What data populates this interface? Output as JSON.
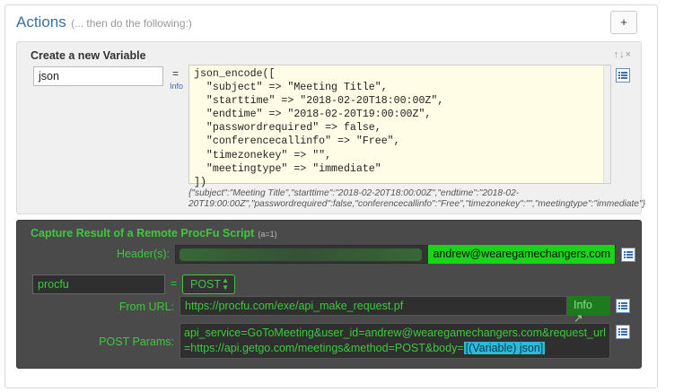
{
  "actions": {
    "title": "Actions",
    "subtitle": "(... then do the following:)",
    "add_label": "+"
  },
  "variable_panel": {
    "title": "Create a new Variable",
    "tools": "↑↓×",
    "name_value": "json",
    "equals": "=",
    "info_link": "Info",
    "code": "json_encode([\n  \"subject\" => \"Meeting Title\",\n  \"starttime\" => \"2018-02-20T18:00:00Z\",\n  \"endtime\" => \"2018-02-20T19:00:00Z\",\n  \"passwordrequired\" => false,\n  \"conferencecallinfo\" => \"Free\",\n  \"timezonekey\" => \"\",\n  \"meetingtype\" => \"immediate\"\n])",
    "result_preview": "{\"subject\":\"Meeting Title\",\"starttime\":\"2018-02-20T18:00:00Z\",\"endtime\":\"2018-02-20T19:00:00Z\",\"passwordrequired\":false,\"conferencecallinfo\":\"Free\",\"timezonekey\":\"\",\"meetingtype\":\"immediate\"}"
  },
  "capture_panel": {
    "title": "Capture Result of a Remote ProcFu Script",
    "subtitle": "(a=1)",
    "headers_label": "Header(s):",
    "header_email": "andrew@wearegamechangers.com",
    "variable_name": "procfu",
    "equals": "=",
    "method": "POST",
    "from_url_label": "From URL:",
    "url_value": "https://procfu.com/exe/api_make_request.pf",
    "info_button": "Info ↗",
    "post_params_label": "POST Params:",
    "post_params_value": "api_service=GoToMeeting&user_id=andrew@wearegamechangers.com&request_url=https://api.getgo.com/meetings&method=POST&body=",
    "post_params_variable": "[(Variable) json]"
  },
  "colors": {
    "accent_green": "#3fc83f",
    "title_blue": "#3d6fa0",
    "dark_panel": "#4a4a4a",
    "code_bg": "#fffde6"
  }
}
